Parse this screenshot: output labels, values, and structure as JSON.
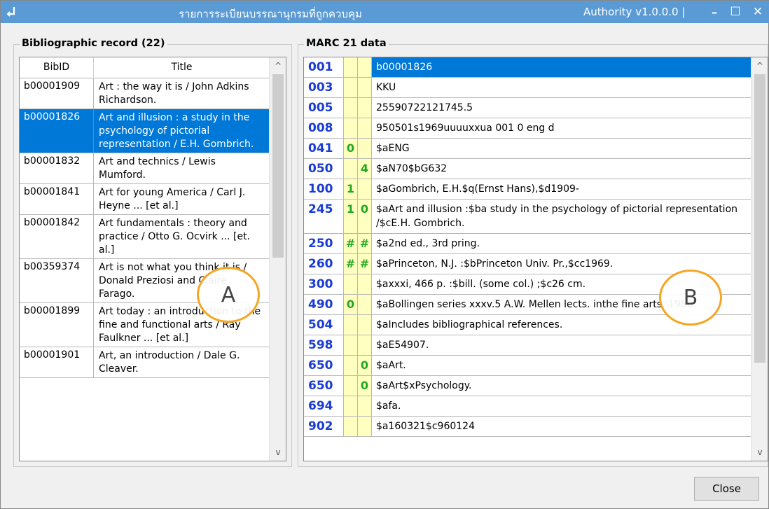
{
  "window": {
    "title": "รายการระเบียนบรรณานุกรมที่ถูกควบคุม",
    "version": "Authority v1.0.0.0 |",
    "minimize_glyph": "–",
    "maximize_glyph": "☐",
    "close_glyph": "✕",
    "accent": "#5b9bd5"
  },
  "left_panel": {
    "title": "Bibliographic record (22)",
    "columns": [
      "BibID",
      "Title"
    ],
    "rows": [
      {
        "bibid": "b00001909",
        "title": "Art : the way it is / John Adkins Richardson."
      },
      {
        "bibid": "b00001826",
        "title": "Art and illusion : a study in the psychology of pictorial representation / E.H. Gombrich."
      },
      {
        "bibid": "b00001832",
        "title": "Art and technics / Lewis Mumford."
      },
      {
        "bibid": "b00001841",
        "title": "Art for young America / Carl J. Heyne ... [et al.]"
      },
      {
        "bibid": "b00001842",
        "title": "Art fundamentals : theory and practice / Otto G. Ocvirk ... [et. al.]"
      },
      {
        "bibid": "b00359374",
        "title": "Art is not what you think it is / Donald Preziosi and Claire Farago."
      },
      {
        "bibid": "b00001899",
        "title": "Art today : an introduction to the fine and functional arts / Ray Faulkner ... [et al.]"
      },
      {
        "bibid": "b00001901",
        "title": "Art, an introduction / Dale G. Cleaver."
      }
    ],
    "selected_index": 1,
    "scroll_up": "^",
    "scroll_down": "v"
  },
  "right_panel": {
    "title": "MARC 21 data",
    "rows": [
      {
        "tag": "001",
        "ind1": "",
        "ind2": "",
        "value": "b00001826"
      },
      {
        "tag": "003",
        "ind1": "",
        "ind2": "",
        "value": "KKU"
      },
      {
        "tag": "005",
        "ind1": "",
        "ind2": "",
        "value": "25590722121745.5"
      },
      {
        "tag": "008",
        "ind1": "",
        "ind2": "",
        "value": "950501s1969uuuuxxua         001 0 eng d"
      },
      {
        "tag": "041",
        "ind1": "0",
        "ind2": "",
        "value": "$aENG"
      },
      {
        "tag": "050",
        "ind1": "",
        "ind2": "4",
        "value": "$aN70$bG632"
      },
      {
        "tag": "100",
        "ind1": "1",
        "ind2": "",
        "value": "$aGombrich, E.H.$q(Ernst Hans),$d1909-"
      },
      {
        "tag": "245",
        "ind1": "1",
        "ind2": "0",
        "value": "$aArt and illusion :$ba study in the psychology of pictorial representation /$cE.H. Gombrich."
      },
      {
        "tag": "250",
        "ind1": "#",
        "ind2": "#",
        "value": "$a2nd ed., 3rd pring."
      },
      {
        "tag": "260",
        "ind1": "#",
        "ind2": "#",
        "value": "$aPrinceton, N.J. :$bPrinceton Univ. Pr.,$cc1969."
      },
      {
        "tag": "300",
        "ind1": "",
        "ind2": "",
        "value": "$axxxi, 466 p. :$bill. (some col.) ;$c26 cm."
      },
      {
        "tag": "490",
        "ind1": "0",
        "ind2": "",
        "value": "$aBollingen series xxxv.5 A.W. Mellen lects. inthe fine arts, 1956."
      },
      {
        "tag": "504",
        "ind1": "",
        "ind2": "",
        "value": "$aIncludes bibliographical references."
      },
      {
        "tag": "598",
        "ind1": "",
        "ind2": "",
        "value": "$aE54907."
      },
      {
        "tag": "650",
        "ind1": "",
        "ind2": "0",
        "value": "$aArt."
      },
      {
        "tag": "650",
        "ind1": "",
        "ind2": "0",
        "value": "$aArt$xPsychology."
      },
      {
        "tag": "694",
        "ind1": "",
        "ind2": "",
        "value": "$afa."
      },
      {
        "tag": "902",
        "ind1": "",
        "ind2": "",
        "value": "$a160321$c960124"
      }
    ],
    "selected_index": 0,
    "scroll_up": "^",
    "scroll_down": "v"
  },
  "annotations": {
    "a": "A",
    "b": "B",
    "color": "#f5a623"
  },
  "footer": {
    "close_label": "Close"
  }
}
